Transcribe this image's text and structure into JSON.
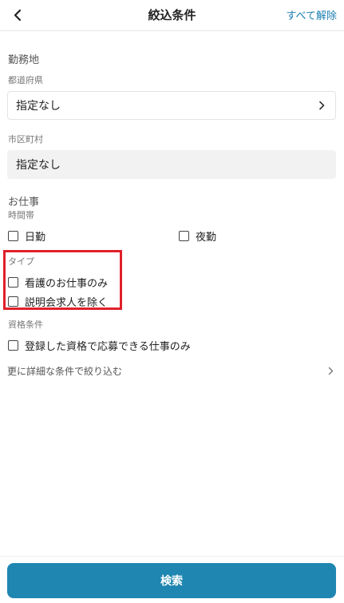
{
  "header": {
    "title": "絞込条件",
    "clear_all_label": "すべて解除"
  },
  "work_location": {
    "section_title": "勤務地",
    "prefecture": {
      "label": "都道府県",
      "value": "指定なし"
    },
    "city": {
      "label": "市区町村",
      "value": "指定なし"
    }
  },
  "job": {
    "section_title": "お仕事",
    "time_slot": {
      "label": "時間帯",
      "options": [
        {
          "label": "日勤",
          "checked": false
        },
        {
          "label": "夜勤",
          "checked": false
        }
      ]
    },
    "type": {
      "label": "タイプ",
      "options": [
        {
          "label": "看護のお仕事のみ",
          "checked": false
        },
        {
          "label": "説明会求人を除く",
          "checked": false
        }
      ]
    },
    "qualification": {
      "label": "資格条件",
      "options": [
        {
          "label": "登録した資格で応募できる仕事のみ",
          "checked": false
        }
      ]
    }
  },
  "detail_link_label": "更に詳細な条件で絞り込む",
  "search_button_label": "検索",
  "colors": {
    "accent": "#1e86b1",
    "link": "#1b7fb0",
    "highlight": "#e0202a"
  },
  "icons": {
    "back": "chevron-left-icon",
    "select": "chevron-right-icon",
    "detail": "chevron-right-icon"
  }
}
